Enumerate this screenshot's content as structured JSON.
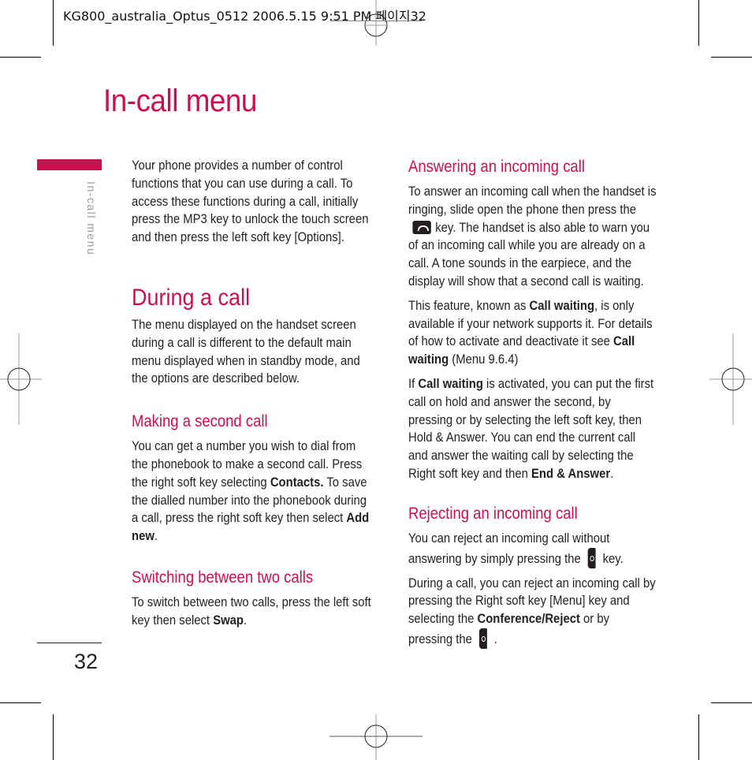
{
  "print_slug": "KG800_australia_Optus_0512 2006.5.15 9:51 PM 페이지32",
  "page_title": "In-call menu",
  "side_tab_label": "In-call menu",
  "page_number": "32",
  "left_column": {
    "intro": "Your phone provides a number of control functions that you can use during a call. To access these functions during a call, initially press the MP3 key to unlock the touch screen and then press the left soft key [Options].",
    "during_heading": "During a call",
    "during_text": "The menu displayed on the handset screen during a call is different to the default main menu displayed when in standby mode, and the options are described below.",
    "making_heading": "Making a second call",
    "making_text_1": "You can get a number you wish to dial from the phonebook to make a second call. Press the right soft key selecting ",
    "making_bold_1": "Contacts.",
    "making_text_2": " To save the dialled number into the phonebook during a call, press the right soft key then select ",
    "making_bold_2": "Add new",
    "making_text_3": ".",
    "switching_heading": "Switching between two calls",
    "switching_text_1": "To switch between two calls, press the left soft key then select ",
    "switching_bold": "Swap",
    "switching_text_2": "."
  },
  "right_column": {
    "answering_heading": "Answering an incoming call",
    "answering_text_1": "To answer an incoming call when the handset is ringing, slide open the phone then press the",
    "answering_text_2": "key. The handset is also able to warn you of an incoming call while you are already on a call. A tone sounds in the earpiece, and the display will show that a second call is waiting.",
    "feature_text_1": "This feature, known as ",
    "feature_bold_1": "Call waiting",
    "feature_text_2": ", is only available if your network supports it. For details of how to activate and deactivate it see ",
    "feature_bold_2": "Call waiting",
    "feature_text_3": " (Menu 9.6.4)",
    "if_text_1": "If ",
    "if_bold_1": "Call waiting",
    "if_text_2": " is activated, you can put the first call on hold and answer the second, by pressing or by selecting the left soft key, then Hold & Answer. You can end the current call and answer the waiting call by selecting the Right soft key and then ",
    "if_bold_2": "End & Answer",
    "if_text_3": ".",
    "rejecting_heading": "Rejecting an incoming call",
    "reject_text_1": "You can reject an incoming call without answering by simply pressing the",
    "reject_text_2": "key.",
    "during_reject_text_1": "During a call, you can reject an incoming call by pressing the Right soft key [Menu] key and selecting the ",
    "during_reject_bold": "Conference/Reject",
    "during_reject_text_2": " or by pressing the",
    "during_reject_text_3": "."
  },
  "icons": {
    "send_key": "phone-send-key-icon",
    "end_key": "side-end-key-icon"
  },
  "colors": {
    "accent": "#c8104d",
    "text": "#231f20",
    "side_label": "#9a9a9a"
  }
}
